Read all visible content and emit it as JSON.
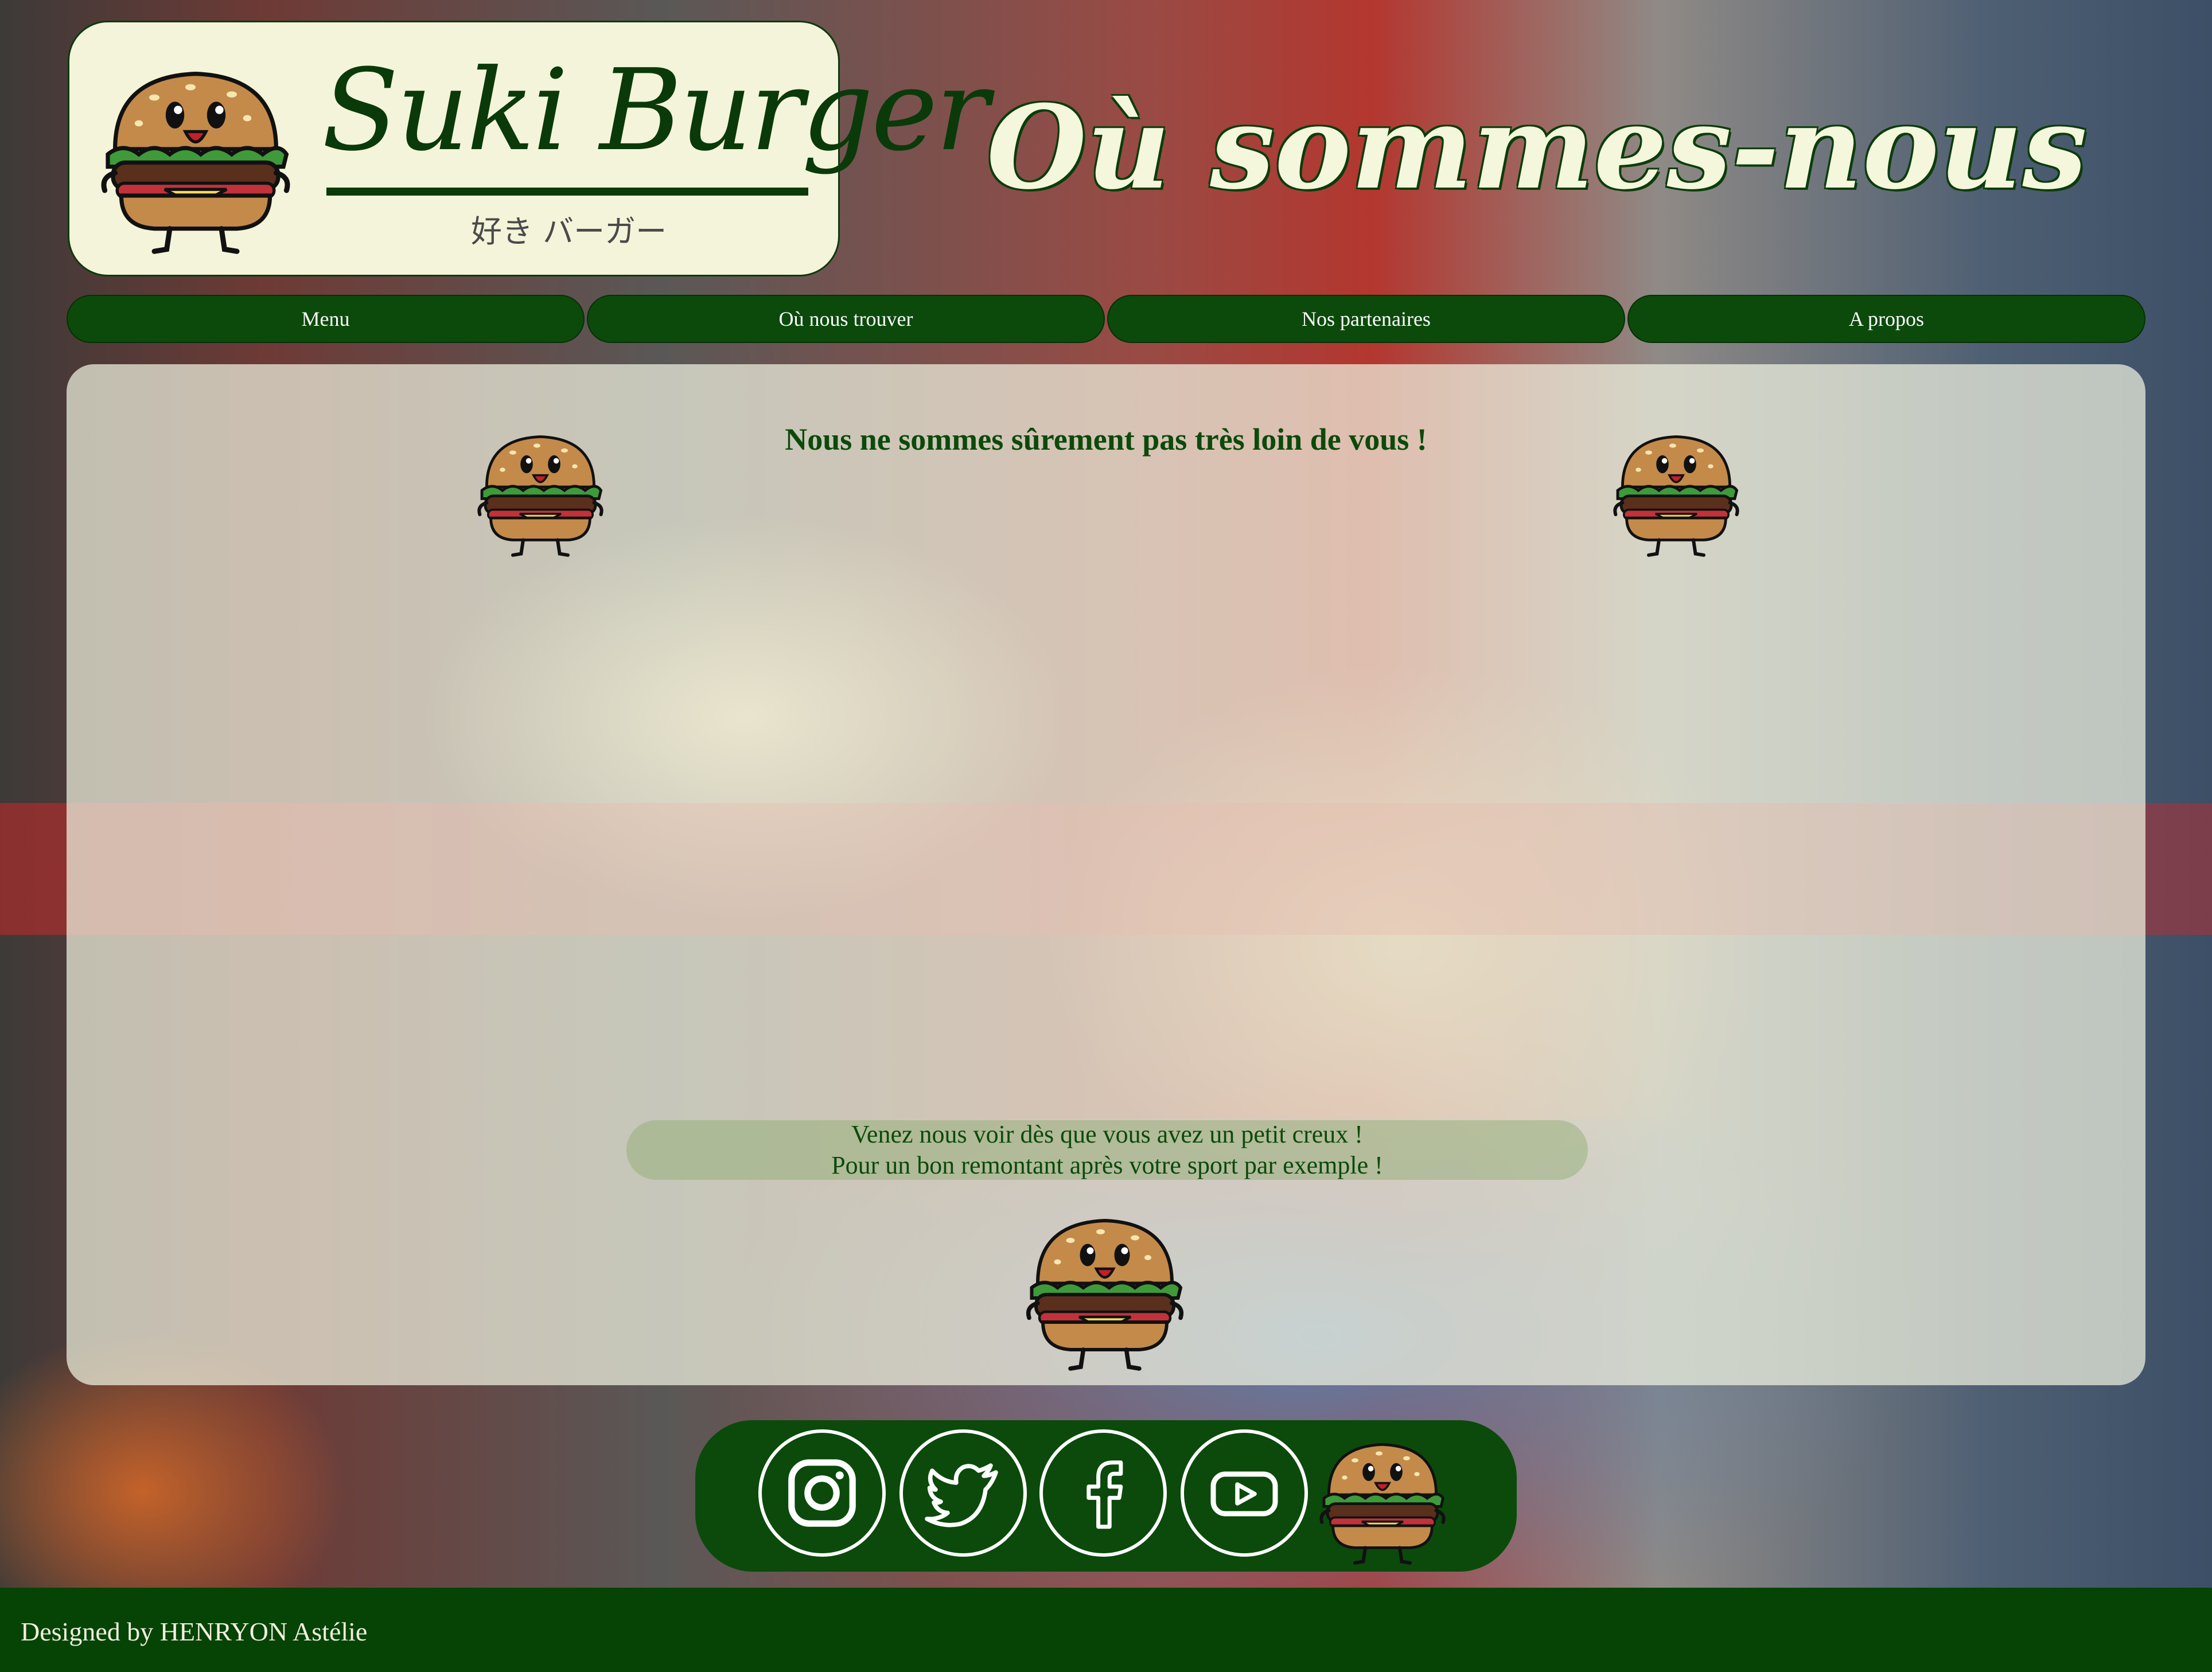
{
  "brand": {
    "name": "Suki Burger",
    "subtitle": "好き バーガー"
  },
  "page_title": "Où sommes-nous",
  "nav": {
    "items": [
      {
        "label": "Menu"
      },
      {
        "label": "Où nous trouver"
      },
      {
        "label": "Nos partenaires"
      },
      {
        "label": "A propos"
      }
    ]
  },
  "main": {
    "heading": "Nous ne sommes sûrement pas très loin de vous !",
    "info_line1": "Venez nous voir dès que vous avez un petit creux !",
    "info_line2": "Pour un bon remontant après votre sport par exemple !"
  },
  "social": {
    "icons": [
      "instagram-icon",
      "twitter-icon",
      "facebook-icon",
      "youtube-icon"
    ]
  },
  "footer": {
    "credit": "Designed by HENRYON Astélie"
  },
  "colors": {
    "primary_green": "#0b4a0b",
    "cream": "#f4f4da",
    "footer_green": "#064406"
  }
}
